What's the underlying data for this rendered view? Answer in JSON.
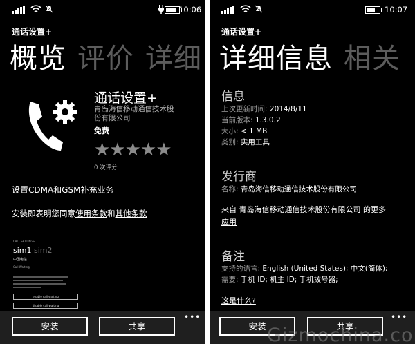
{
  "left": {
    "status": {
      "time": "10:06"
    },
    "app_title": "通话设置+",
    "pivot": [
      "概览",
      "评价",
      "详细"
    ],
    "app": {
      "name": "通话设置+",
      "publisher": "青岛海信移动通信技术股份有限公司",
      "price": "免费",
      "rating_stars": 0,
      "rating_count": "0 次评分"
    },
    "description": "设置CDMA和GSM补充业务",
    "terms": {
      "prefix": "安装即表明您同意",
      "link1": "使用条款",
      "mid": "和",
      "link2": "其他条款"
    },
    "screenshot": {
      "header": "CALL SETTINGS",
      "sim1": "sim1",
      "sim2": "sim2",
      "carrier": "中国电信",
      "section": "Call Waiting",
      "enable_btn": "enable call waiting",
      "disable_btn": "disable call waiting"
    },
    "appbar": {
      "install": "安装",
      "share": "共享",
      "more": "•••"
    }
  },
  "right": {
    "status": {
      "time": "10:07"
    },
    "app_title": "通话设置+",
    "pivot": [
      "详细信息",
      "相关"
    ],
    "info": {
      "heading": "信息",
      "updated_label": "上次更新时间:",
      "updated_value": "2014/8/11",
      "version_label": "当前版本:",
      "version_value": "1.3.0.2",
      "size_label": "大小:",
      "size_value": "< 1 MB",
      "category_label": "类别:",
      "category_value": "实用工具"
    },
    "publisher": {
      "heading": "发行商",
      "name_label": "名称:",
      "name_value": "青岛海信移动通信技术股份有限公司",
      "more_link_line1": "来自 青岛海信移动通信技术股份有限公司 的更多",
      "more_link_line2": "应用"
    },
    "notes": {
      "heading": "备注",
      "lang_label": "支持的语言:",
      "lang_value": "English (United States); 中文(简体);",
      "needs_label": "需要:",
      "needs_value": "手机 ID; 机主 ID; 手机拨号器;",
      "what_link": "这是什么?"
    },
    "appbar": {
      "install": "安装",
      "share": "共享",
      "more": "•••"
    }
  },
  "watermark": "Gizmochina.com"
}
